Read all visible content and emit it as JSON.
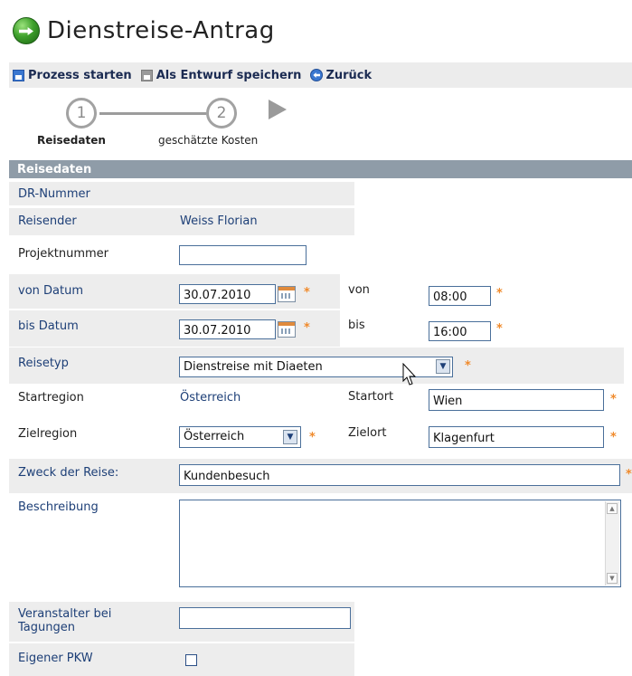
{
  "header": {
    "title": "Dienstreise-Antrag",
    "icon": "globe-arrow-icon"
  },
  "toolbar": {
    "start_label": "Prozess starten",
    "draft_label": "Als Entwurf speichern",
    "back_label": "Zurück"
  },
  "steps": [
    {
      "number": "1",
      "label": "Reisedaten",
      "active": true
    },
    {
      "number": "2",
      "label": "geschätzte Kosten",
      "active": false
    }
  ],
  "section": {
    "title": "Reisedaten"
  },
  "form": {
    "dr_nummer_label": "DR-Nummer",
    "reisender_label": "Reisender",
    "reisender_value": "Weiss Florian",
    "projektnummer_label": "Projektnummer",
    "projektnummer_value": "",
    "von_datum_label": "von Datum",
    "von_datum_value": "30.07.2010",
    "von_label": "von",
    "von_value": "08:00",
    "bis_datum_label": "bis Datum",
    "bis_datum_value": "30.07.2010",
    "bis_label": "bis",
    "bis_value": "16:00",
    "reisetyp_label": "Reisetyp",
    "reisetyp_value": "Dienstreise mit Diaeten",
    "startregion_label": "Startregion",
    "startregion_value": "Österreich",
    "startort_label": "Startort",
    "startort_value": "Wien",
    "zielregion_label": "Zielregion",
    "zielregion_value": "Österreich",
    "zielort_label": "Zielort",
    "zielort_value": "Klagenfurt",
    "zweck_label": "Zweck der Reise:",
    "zweck_value": "Kundenbesuch",
    "beschreibung_label": "Beschreibung",
    "beschreibung_value": "",
    "veranstalter_label": "Veranstalter bei Tagungen",
    "veranstalter_value": "",
    "pkw_label": "Eigener PKW",
    "pkw_checked": false,
    "required_mark": "*"
  },
  "colors": {
    "accent": "#1d3f77",
    "required": "#f08a2b",
    "section_bar": "#8f9ca8",
    "toolbar_bg": "#ececec"
  }
}
